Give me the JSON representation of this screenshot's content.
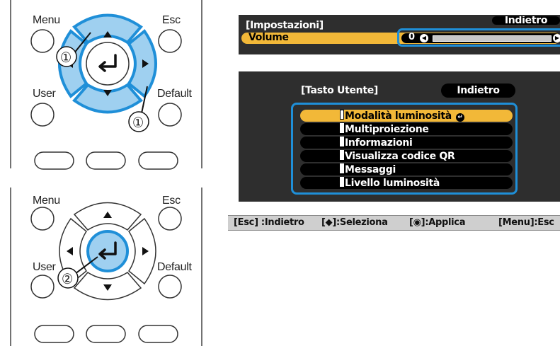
{
  "remote_top": {
    "menu_label": "Menu",
    "esc_label": "Esc",
    "user_label": "User",
    "default_label": "Default",
    "step_marker_left": "①",
    "step_marker_right": "①"
  },
  "remote_bottom": {
    "menu_label": "Menu",
    "esc_label": "Esc",
    "user_label": "User",
    "default_label": "Default",
    "step_marker": "②"
  },
  "settings_screen": {
    "title": "[Impostazioni]",
    "back_label": "Indietro",
    "volume_label": "Volume",
    "volume_value": "0",
    "volume_level": 0.0
  },
  "user_key_screen": {
    "title": "[Tasto Utente]",
    "back_label": "Indietro",
    "items": [
      {
        "label": "Modalità luminosità",
        "selected": true
      },
      {
        "label": "Multiproiezione",
        "selected": false
      },
      {
        "label": "Informazioni",
        "selected": false
      },
      {
        "label": "Visualizza codice QR",
        "selected": false
      },
      {
        "label": "Messaggi",
        "selected": false
      },
      {
        "label": "Livello luminosità",
        "selected": false
      }
    ]
  },
  "help_bar": {
    "esc": "[Esc] :Indietro",
    "select": "[◆]:Seleziona",
    "apply": "[◉]:Applica",
    "menu": "[Menu]:Esc"
  },
  "colors": {
    "highlight_blue": "#1f8fd8",
    "key_blue": "#9fd0f0",
    "selection_orange": "#f2b838",
    "screen_bg": "#2e2e2e"
  }
}
